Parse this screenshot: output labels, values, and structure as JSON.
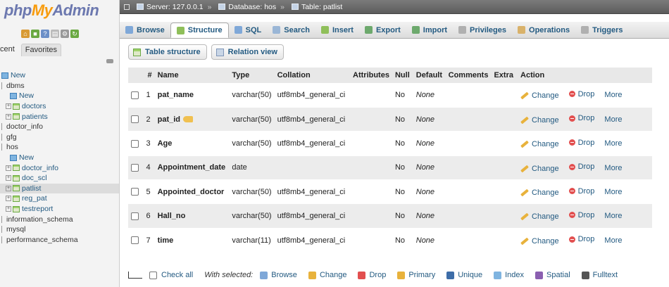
{
  "app": {
    "logo_php": "php",
    "logo_my": "My",
    "logo_admin": "Admin"
  },
  "sidebar": {
    "tabs": [
      "cent",
      "Favorites"
    ],
    "tree": [
      {
        "label": "New",
        "kind": "new",
        "indent": 0
      },
      {
        "label": "dbms",
        "kind": "db",
        "indent": 0
      },
      {
        "label": "New",
        "kind": "new",
        "indent": 2
      },
      {
        "label": "doctors",
        "kind": "tbl",
        "indent": 1
      },
      {
        "label": "patients",
        "kind": "tbl",
        "indent": 1
      },
      {
        "label": "doctor_info",
        "kind": "db",
        "indent": 0
      },
      {
        "label": "gfg",
        "kind": "db",
        "indent": 0
      },
      {
        "label": "hos",
        "kind": "db",
        "indent": 0
      },
      {
        "label": "New",
        "kind": "new",
        "indent": 2
      },
      {
        "label": "doctor_info",
        "kind": "tbl",
        "indent": 1
      },
      {
        "label": "doc_scl",
        "kind": "tbl",
        "indent": 1
      },
      {
        "label": "patlist",
        "kind": "tbl",
        "indent": 1,
        "selected": true
      },
      {
        "label": "reg_pat",
        "kind": "tbl",
        "indent": 1
      },
      {
        "label": "testreport",
        "kind": "tbl",
        "indent": 1
      },
      {
        "label": "information_schema",
        "kind": "db",
        "indent": 0
      },
      {
        "label": "mysql",
        "kind": "db",
        "indent": 0
      },
      {
        "label": "performance_schema",
        "kind": "db",
        "indent": 0
      }
    ]
  },
  "breadcrumb": {
    "server": "Server: 127.0.0.1",
    "database": "Database: hos",
    "table": "Table: patlist"
  },
  "tabs": [
    {
      "label": "Browse",
      "color": "#7fa8d8"
    },
    {
      "label": "Structure",
      "color": "#8fbf5a",
      "active": true
    },
    {
      "label": "SQL",
      "color": "#7fa8d8"
    },
    {
      "label": "Search",
      "color": "#9ab6d6"
    },
    {
      "label": "Insert",
      "color": "#8fbf5a"
    },
    {
      "label": "Export",
      "color": "#6da96d"
    },
    {
      "label": "Import",
      "color": "#6da96d"
    },
    {
      "label": "Privileges",
      "color": "#b0b0b0"
    },
    {
      "label": "Operations",
      "color": "#d9b26a"
    },
    {
      "label": "Triggers",
      "color": "#b0b0b0"
    }
  ],
  "subtabs": [
    {
      "label": "Table structure"
    },
    {
      "label": "Relation view"
    }
  ],
  "columns": [
    "",
    "#",
    "Name",
    "Type",
    "Collation",
    "Attributes",
    "Null",
    "Default",
    "Comments",
    "Extra",
    "Action"
  ],
  "rows": [
    {
      "num": "1",
      "name": "pat_name",
      "type": "varchar(50)",
      "collation": "utf8mb4_general_ci",
      "null": "No",
      "default": "None"
    },
    {
      "num": "2",
      "name": "pat_id",
      "type": "varchar(50)",
      "collation": "utf8mb4_general_ci",
      "null": "No",
      "default": "None",
      "key": true
    },
    {
      "num": "3",
      "name": "Age",
      "type": "varchar(50)",
      "collation": "utf8mb4_general_ci",
      "null": "No",
      "default": "None"
    },
    {
      "num": "4",
      "name": "Appointment_date",
      "type": "date",
      "collation": "",
      "null": "No",
      "default": "None"
    },
    {
      "num": "5",
      "name": "Appointed_doctor",
      "type": "varchar(50)",
      "collation": "utf8mb4_general_ci",
      "null": "No",
      "default": "None"
    },
    {
      "num": "6",
      "name": "Hall_no",
      "type": "varchar(50)",
      "collation": "utf8mb4_general_ci",
      "null": "No",
      "default": "None"
    },
    {
      "num": "7",
      "name": "time",
      "type": "varchar(11)",
      "collation": "utf8mb4_general_ci",
      "null": "No",
      "default": "None"
    }
  ],
  "row_actions": {
    "change": "Change",
    "drop": "Drop",
    "more": "More"
  },
  "footer": {
    "check_all": "Check all",
    "with_selected": "With selected:",
    "buttons": [
      {
        "label": "Browse",
        "color": "#7fa8d8"
      },
      {
        "label": "Change",
        "color": "#e8b23c"
      },
      {
        "label": "Drop",
        "color": "#e24f4f"
      },
      {
        "label": "Primary",
        "color": "#e8b23c"
      },
      {
        "label": "Unique",
        "color": "#3d6da8"
      },
      {
        "label": "Index",
        "color": "#7fb4e0"
      },
      {
        "label": "Spatial",
        "color": "#8a5fb0"
      },
      {
        "label": "Fulltext",
        "color": "#555555"
      }
    ]
  }
}
